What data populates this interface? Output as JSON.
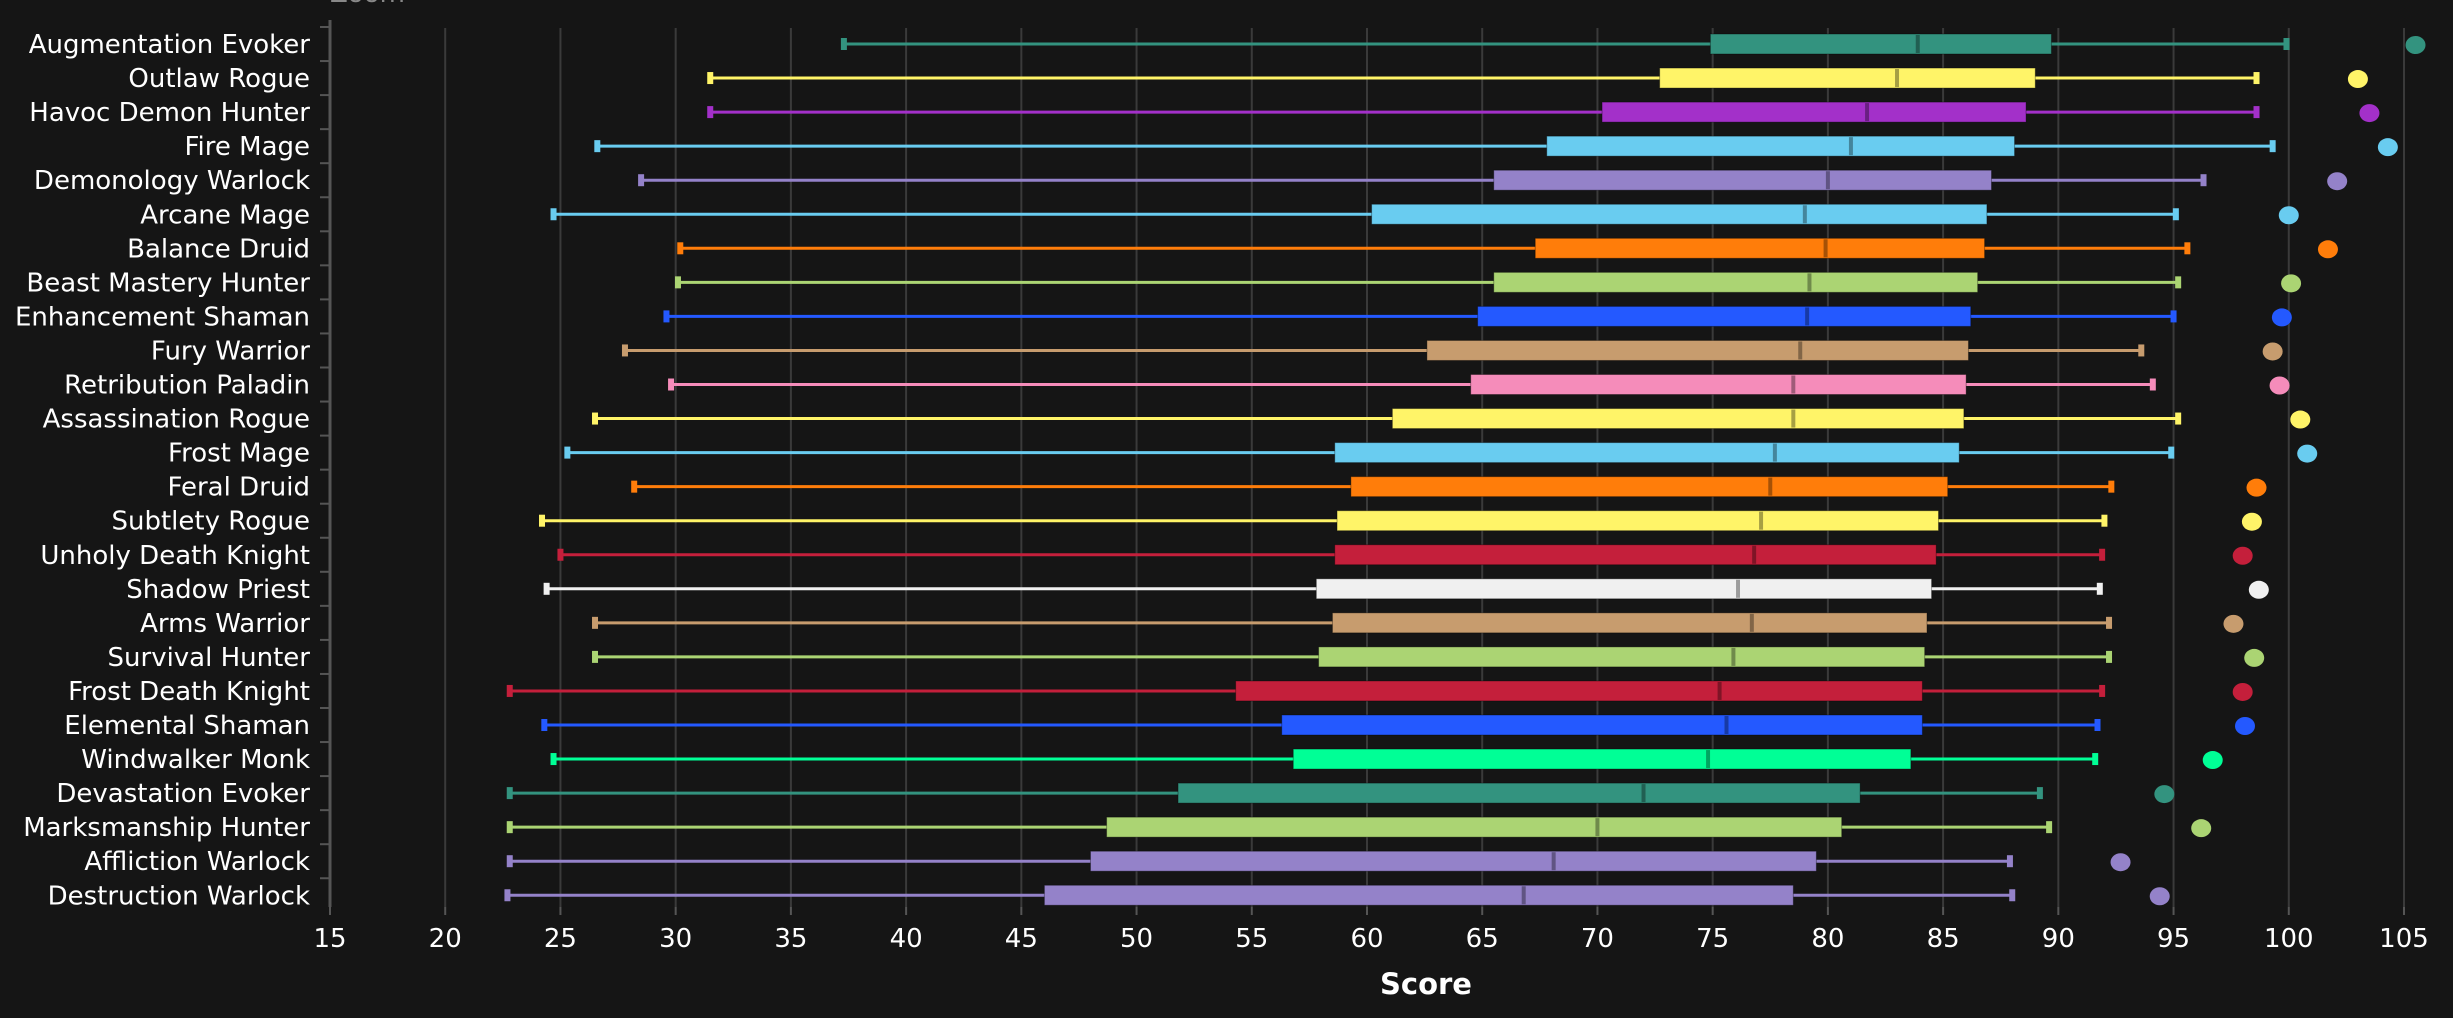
{
  "chart_data": {
    "type": "boxplot",
    "title": "",
    "corner_label": "Zoom",
    "xlabel": "Score",
    "ylabel": "",
    "xlim": [
      15,
      106
    ],
    "xticks": [
      15,
      20,
      25,
      30,
      35,
      40,
      45,
      50,
      55,
      60,
      65,
      70,
      75,
      80,
      85,
      90,
      95,
      100,
      105
    ],
    "grid": true,
    "categories": [
      "Augmentation Evoker",
      "Outlaw Rogue",
      "Havoc Demon Hunter",
      "Fire Mage",
      "Demonology Warlock",
      "Arcane Mage",
      "Balance Druid",
      "Beast Mastery Hunter",
      "Enhancement Shaman",
      "Fury Warrior",
      "Retribution Paladin",
      "Assassination Rogue",
      "Frost Mage",
      "Feral Druid",
      "Subtlety Rogue",
      "Unholy Death Knight",
      "Shadow Priest",
      "Arms Warrior",
      "Survival Hunter",
      "Frost Death Knight",
      "Elemental Shaman",
      "Windwalker Monk",
      "Devastation Evoker",
      "Marksmanship Hunter",
      "Affliction Warlock",
      "Destruction Warlock"
    ],
    "series": [
      {
        "name": "Augmentation Evoker",
        "color": "#33937F",
        "min": 37.3,
        "q1": 74.9,
        "median": 83.9,
        "q3": 89.7,
        "max": 99.9,
        "max_point": 105.5
      },
      {
        "name": "Outlaw Rogue",
        "color": "#FFF468",
        "min": 31.5,
        "q1": 72.7,
        "median": 83.0,
        "q3": 89.0,
        "max": 98.6,
        "max_point": 103.0
      },
      {
        "name": "Havoc Demon Hunter",
        "color": "#A330C9",
        "min": 31.5,
        "q1": 70.2,
        "median": 81.7,
        "q3": 88.6,
        "max": 98.6,
        "max_point": 103.5
      },
      {
        "name": "Fire Mage",
        "color": "#69CCF0",
        "min": 26.6,
        "q1": 67.8,
        "median": 81.0,
        "q3": 88.1,
        "max": 99.3,
        "max_point": 104.3
      },
      {
        "name": "Demonology Warlock",
        "color": "#9482C9",
        "min": 28.5,
        "q1": 65.5,
        "median": 80.0,
        "q3": 87.1,
        "max": 96.3,
        "max_point": 102.1
      },
      {
        "name": "Arcane Mage",
        "color": "#69CCF0",
        "min": 24.7,
        "q1": 60.2,
        "median": 79.0,
        "q3": 86.9,
        "max": 95.1,
        "max_point": 100.0
      },
      {
        "name": "Balance Druid",
        "color": "#FF7D0A",
        "min": 30.2,
        "q1": 67.3,
        "median": 79.9,
        "q3": 86.8,
        "max": 95.6,
        "max_point": 101.7
      },
      {
        "name": "Beast Mastery Hunter",
        "color": "#ABD473",
        "min": 30.1,
        "q1": 65.5,
        "median": 79.2,
        "q3": 86.5,
        "max": 95.2,
        "max_point": 100.1
      },
      {
        "name": "Enhancement Shaman",
        "color": "#2459FF",
        "min": 29.6,
        "q1": 64.8,
        "median": 79.1,
        "q3": 86.2,
        "max": 95.0,
        "max_point": 99.7
      },
      {
        "name": "Fury Warrior",
        "color": "#C79C6E",
        "min": 27.8,
        "q1": 62.6,
        "median": 78.8,
        "q3": 86.1,
        "max": 93.6,
        "max_point": 99.3
      },
      {
        "name": "Retribution Paladin",
        "color": "#F58CBA",
        "min": 29.8,
        "q1": 64.5,
        "median": 78.5,
        "q3": 86.0,
        "max": 94.1,
        "max_point": 99.6
      },
      {
        "name": "Assassination Rogue",
        "color": "#FFF468",
        "min": 26.5,
        "q1": 61.1,
        "median": 78.5,
        "q3": 85.9,
        "max": 95.2,
        "max_point": 100.5
      },
      {
        "name": "Frost Mage",
        "color": "#69CCF0",
        "min": 25.3,
        "q1": 58.6,
        "median": 77.7,
        "q3": 85.7,
        "max": 94.9,
        "max_point": 100.8
      },
      {
        "name": "Feral Druid",
        "color": "#FF7D0A",
        "min": 28.2,
        "q1": 59.3,
        "median": 77.5,
        "q3": 85.2,
        "max": 92.3,
        "max_point": 98.6
      },
      {
        "name": "Subtlety Rogue",
        "color": "#FFF468",
        "min": 24.2,
        "q1": 58.7,
        "median": 77.1,
        "q3": 84.8,
        "max": 92.0,
        "max_point": 98.4
      },
      {
        "name": "Unholy Death Knight",
        "color": "#C41F3B",
        "min": 25.0,
        "q1": 58.6,
        "median": 76.8,
        "q3": 84.7,
        "max": 91.9,
        "max_point": 98.0
      },
      {
        "name": "Shadow Priest",
        "color": "#F0F0F0",
        "min": 24.4,
        "q1": 57.8,
        "median": 76.1,
        "q3": 84.5,
        "max": 91.8,
        "max_point": 98.7
      },
      {
        "name": "Arms Warrior",
        "color": "#C79C6E",
        "min": 26.5,
        "q1": 58.5,
        "median": 76.7,
        "q3": 84.3,
        "max": 92.2,
        "max_point": 97.6
      },
      {
        "name": "Survival Hunter",
        "color": "#ABD473",
        "min": 26.5,
        "q1": 57.9,
        "median": 75.9,
        "q3": 84.2,
        "max": 92.2,
        "max_point": 98.5
      },
      {
        "name": "Frost Death Knight",
        "color": "#C41F3B",
        "min": 22.8,
        "q1": 54.3,
        "median": 75.3,
        "q3": 84.1,
        "max": 91.9,
        "max_point": 98.0
      },
      {
        "name": "Elemental Shaman",
        "color": "#2459FF",
        "min": 24.3,
        "q1": 56.3,
        "median": 75.6,
        "q3": 84.1,
        "max": 91.7,
        "max_point": 98.1
      },
      {
        "name": "Windwalker Monk",
        "color": "#00FF96",
        "min": 24.7,
        "q1": 56.8,
        "median": 74.8,
        "q3": 83.6,
        "max": 91.6,
        "max_point": 96.7
      },
      {
        "name": "Devastation Evoker",
        "color": "#33937F",
        "min": 22.8,
        "q1": 51.8,
        "median": 72.0,
        "q3": 81.4,
        "max": 89.2,
        "max_point": 94.6
      },
      {
        "name": "Marksmanship Hunter",
        "color": "#ABD473",
        "min": 22.8,
        "q1": 48.7,
        "median": 70.0,
        "q3": 80.6,
        "max": 89.6,
        "max_point": 96.2
      },
      {
        "name": "Affliction Warlock",
        "color": "#9482C9",
        "min": 22.8,
        "q1": 48.0,
        "median": 68.1,
        "q3": 79.5,
        "max": 87.9,
        "max_point": 92.7
      },
      {
        "name": "Destruction Warlock",
        "color": "#9482C9",
        "min": 22.7,
        "q1": 46.0,
        "median": 66.8,
        "q3": 78.5,
        "max": 88.0,
        "max_point": 94.4
      }
    ]
  }
}
